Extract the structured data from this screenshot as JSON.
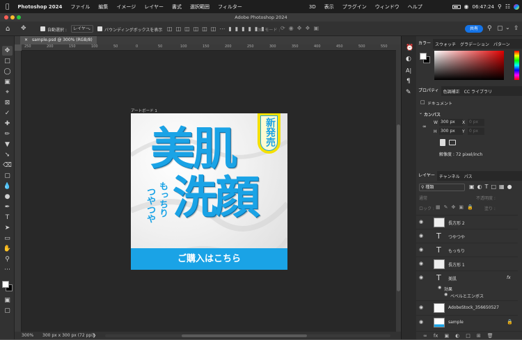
{
  "menubar": {
    "app_name": "Photoshop 2024",
    "items": [
      "ファイル",
      "編集",
      "イメージ",
      "レイヤー",
      "書式",
      "選択範囲",
      "フィルター",
      "3D",
      "表示",
      "プラグイン",
      "ウィンドウ",
      "ヘルプ"
    ],
    "clock": "06:47:24"
  },
  "window_title": "Adobe Photoshop 2024",
  "options": {
    "auto_select_label": "自動選択 :",
    "auto_select_value": "レイヤー",
    "bbox_label": "バウンディングボックスを表示",
    "mode_3d_label": "3D モード :",
    "share_label": "共有"
  },
  "doc": {
    "tab_label": "sample.psd @ 300% (RGB/8)",
    "artboard_label": "アートボード 1",
    "zoom": "300%",
    "size_info": "300 px x 300 px (72 ppi)"
  },
  "ruler_labels": [
    "250",
    "200",
    "150",
    "100",
    "50",
    "0",
    "50",
    "100",
    "150",
    "200",
    "250",
    "300",
    "350",
    "400",
    "450",
    "500",
    "550"
  ],
  "artwork": {
    "badge": "新発売",
    "title_top": "美肌",
    "title_bottom": "洗顔",
    "sub1": "もっちり",
    "sub2": "つやつや",
    "cta": "ご購入はこちら"
  },
  "panels": {
    "color_tabs": [
      "カラー",
      "スウォッチ",
      "グラデーション",
      "パターン"
    ],
    "prop_tabs": [
      "プロパティ",
      "色調補正",
      "CC ライブラリ"
    ],
    "document_label": "ドキュメント",
    "canvas_label": "カンバス",
    "w_label": "W",
    "w_value": "300 px",
    "h_label": "H",
    "h_value": "300 px",
    "x_label": "X",
    "x_placeholder": "0 px",
    "y_label": "Y",
    "y_placeholder": "0 px",
    "resolution": "解像度 : 72 pixel/inch",
    "layer_tabs": [
      "レイヤー",
      "チャンネル",
      "パス"
    ],
    "filter_kind": "種類",
    "blend_mode": "通常",
    "opacity_label": "不透明度 :",
    "lock_label": "ロック :",
    "fill_label": "塗り :"
  },
  "layers": [
    {
      "name": "長方形 2",
      "kind": "shape"
    },
    {
      "name": "つやつや",
      "kind": "text"
    },
    {
      "name": "もっちり",
      "kind": "text"
    },
    {
      "name": "長方形 1",
      "kind": "shape"
    },
    {
      "name": "美肌",
      "kind": "text",
      "fx": "fx"
    },
    {
      "name": "効果",
      "kind": "effect"
    },
    {
      "name": "ベベルとエンボス",
      "kind": "effect"
    },
    {
      "name": "AdobeStock_356650527",
      "kind": "smart"
    },
    {
      "name": "sample",
      "kind": "smart"
    }
  ],
  "colors": {
    "accent_blue": "#1aa3e6",
    "badge_yellow": "#f4e000",
    "share_button": "#1473e6"
  }
}
